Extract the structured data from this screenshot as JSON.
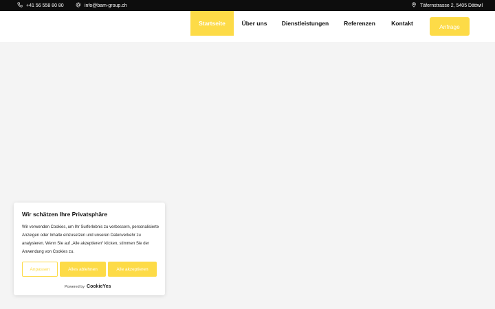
{
  "topbar": {
    "phone": "+41 56 558 80 80",
    "email": "info@bam-group.ch",
    "address": "Täfernstrasse 2, 5405 Dättwil",
    "icons": {
      "phone": "phone-icon",
      "email": "at-icon",
      "address": "location-pin-icon"
    }
  },
  "nav": {
    "items": [
      {
        "label": "Startseite",
        "active": true
      },
      {
        "label": "Über uns",
        "active": false
      },
      {
        "label": "Dienstleistungen",
        "active": false
      },
      {
        "label": "Referenzen",
        "active": false
      },
      {
        "label": "Kontakt",
        "active": false
      }
    ],
    "cta_label": "Anfrage"
  },
  "cookie": {
    "title": "Wir schätzen Ihre Privatsphäre",
    "text": "Wir verwenden Cookies, um Ihr Surferlebnis zu verbessern, personalisierte Anzeigen oder Inhalte einzusetzen und unseren Datenverkehr zu analysieren. Wenn Sie auf „Alle akzeptieren“ klicken, stimmen Sie der Anwendung von Cookies zu.",
    "buttons": {
      "customize": "Anpassen",
      "reject": "Alles ablehnen",
      "accept": "Alle akzeptieren"
    },
    "powered_by": "Powered by",
    "brand": "CookieYes"
  },
  "colors": {
    "accent": "#fddb47",
    "topbar": "#0d0d0d",
    "page_bg": "#f4f4f4"
  }
}
